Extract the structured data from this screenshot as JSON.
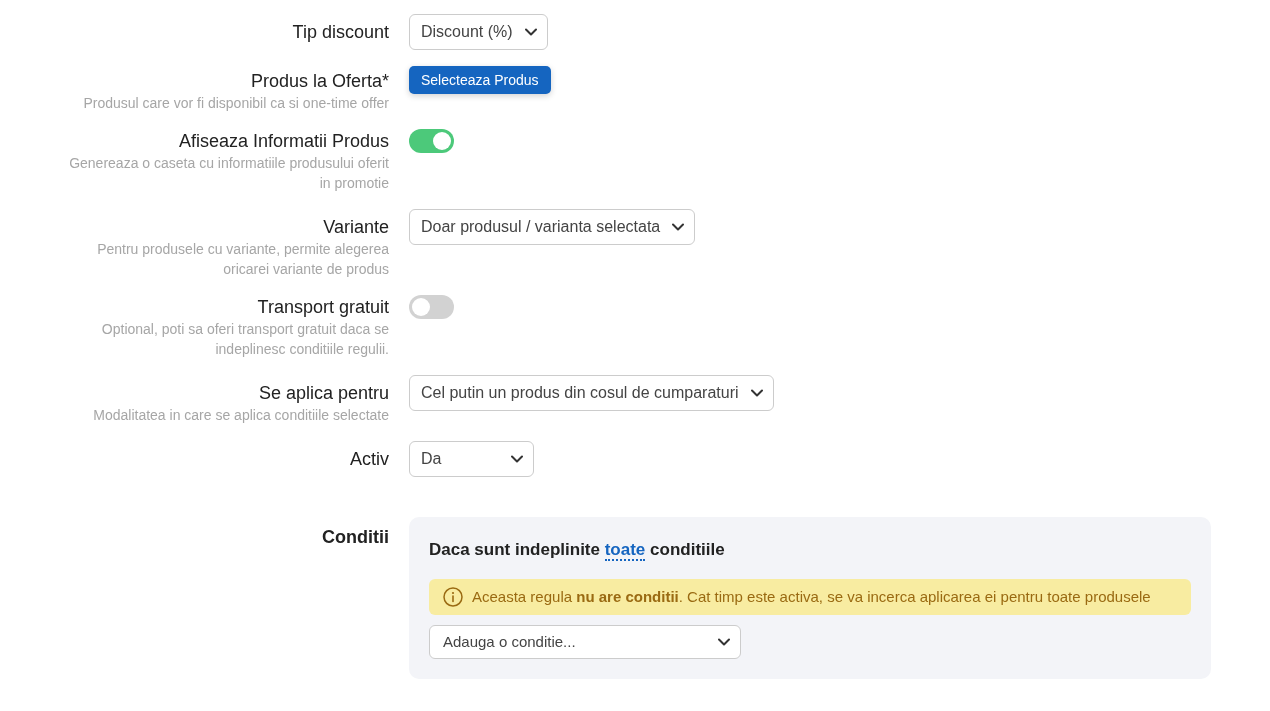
{
  "fields": [
    {
      "kind": "select",
      "label": "Tip discount",
      "value": "Discount (%)"
    },
    {
      "kind": "button",
      "label": "Produs la Oferta*",
      "button": "Selecteaza Produs",
      "description": "Produsul care vor fi disponibil ca si one-time offer"
    },
    {
      "kind": "toggle",
      "label": "Afiseaza Informatii Produs",
      "on": true,
      "description": "Genereaza o caseta cu informatiile produsului oferit\nin promotie"
    },
    {
      "kind": "select",
      "label": "Variante",
      "value": "Doar produsul / varianta selectata",
      "description": "Pentru produsele cu variante, permite alegerea\noricarei variante de produs"
    },
    {
      "kind": "toggle",
      "label": "Transport gratuit",
      "on": false,
      "description": "Optional, poti sa oferi transport gratuit daca se\nindeplinesc conditiile regulii."
    },
    {
      "kind": "select",
      "label": "Se aplica pentru",
      "value": "Cel putin un produs din cosul de cumparaturi",
      "description": "Modalitatea in care se aplica conditiile selectate"
    },
    {
      "kind": "select",
      "label": "Activ",
      "value": "Da"
    }
  ],
  "conditions": {
    "label": "Conditii",
    "heading": {
      "before": "Daca sunt indeplinite",
      "link": "toate",
      "after": "conditiile"
    },
    "alert": "Aceasta regula **nu are conditii**. Cat timp este activa, se va incerca aplicarea ei pentru toate produsele",
    "add_select": {
      "value": "Adauga o conditie..."
    }
  }
}
